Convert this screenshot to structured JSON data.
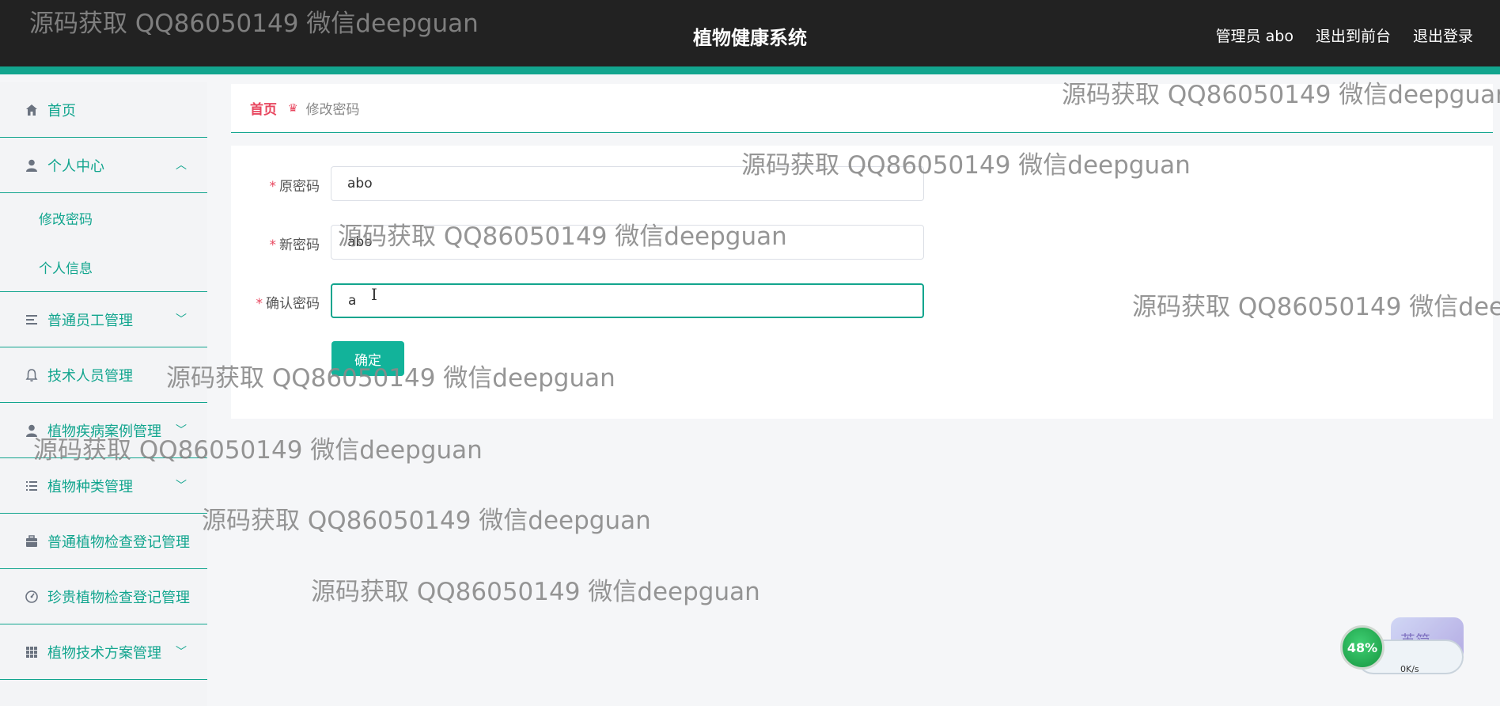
{
  "app": {
    "title": "植物健康系统",
    "user": "管理员 abo",
    "front_link": "退出到前台",
    "logout": "退出登录"
  },
  "sidebar": {
    "items": [
      {
        "label": "首页",
        "icon": "home-icon"
      },
      {
        "label": "个人中心",
        "icon": "user-icon",
        "expanded": true,
        "children": [
          {
            "label": "修改密码"
          },
          {
            "label": "个人信息"
          }
        ]
      },
      {
        "label": "普通员工管理",
        "icon": "list-icon"
      },
      {
        "label": "技术人员管理",
        "icon": "bell-icon"
      },
      {
        "label": "植物疾病案例管理",
        "icon": "user-icon"
      },
      {
        "label": "植物种类管理",
        "icon": "list-icon"
      },
      {
        "label": "普通植物检查登记管理",
        "icon": "briefcase-icon"
      },
      {
        "label": "珍贵植物检查登记管理",
        "icon": "gauge-icon"
      },
      {
        "label": "植物技术方案管理",
        "icon": "grid-icon"
      }
    ]
  },
  "breadcrumb": {
    "home": "首页",
    "current": "修改密码"
  },
  "form": {
    "old_password_label": "原密码",
    "old_password_value": "abo",
    "new_password_label": "新密码",
    "new_password_value": "abo",
    "confirm_password_label": "确认密码",
    "confirm_password_value": "a",
    "required_mark": "*",
    "submit_label": "确定"
  },
  "watermark": "源码获取 QQ86050149 微信deepguan",
  "net_monitor": {
    "percent": "48%",
    "speed": "0K/s",
    "ime_label": "英简"
  },
  "colors": {
    "accent": "#12a58e",
    "topbar": "#222222",
    "breadcrumb_home": "#e8475f",
    "button": "#12b39a"
  }
}
